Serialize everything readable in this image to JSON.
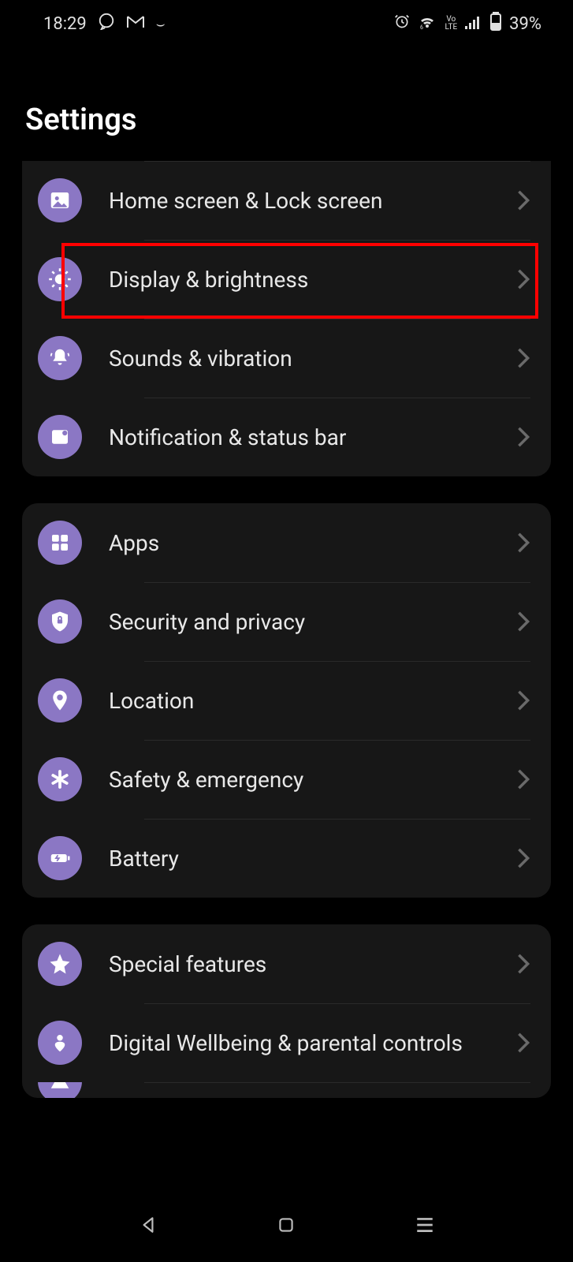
{
  "status": {
    "time": "18:29",
    "battery": "39%",
    "volte": "Vo\nLTE"
  },
  "page_title": "Settings",
  "groups": [
    {
      "items": [
        {
          "icon": "picture",
          "label": "Home screen & Lock screen"
        },
        {
          "icon": "brightness",
          "label": "Display & brightness",
          "highlighted": true
        },
        {
          "icon": "bell",
          "label": "Sounds & vibration"
        },
        {
          "icon": "notification",
          "label": "Notification & status bar"
        }
      ]
    },
    {
      "items": [
        {
          "icon": "apps",
          "label": "Apps"
        },
        {
          "icon": "shield",
          "label": "Security and privacy"
        },
        {
          "icon": "location",
          "label": "Location"
        },
        {
          "icon": "asterisk",
          "label": "Safety & emergency"
        },
        {
          "icon": "battery",
          "label": "Battery"
        }
      ]
    },
    {
      "items": [
        {
          "icon": "star",
          "label": "Special features"
        },
        {
          "icon": "heart-person",
          "label": "Digital Wellbeing & parental controls"
        }
      ]
    }
  ]
}
